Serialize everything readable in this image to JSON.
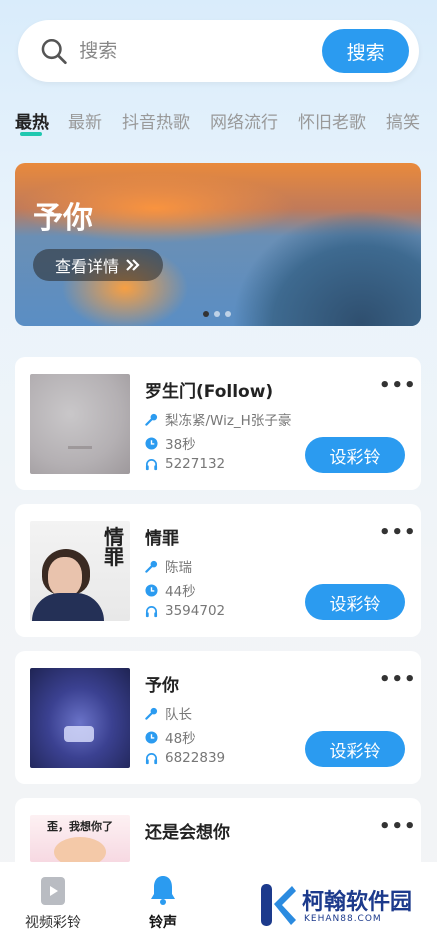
{
  "search": {
    "placeholder": "搜索",
    "button_label": "搜索"
  },
  "tabs": [
    "最热",
    "最新",
    "抖音热歌",
    "网络流行",
    "怀旧老歌",
    "搞笑"
  ],
  "active_tab": "最热",
  "banner": {
    "title": "予你",
    "button_label": "查看详情",
    "page_indicator": {
      "count": 3,
      "active": 1
    }
  },
  "songs": [
    {
      "title": "罗生门(Follow)",
      "artist": "梨冻紧/Wiz_H张子豪",
      "duration": "38秒",
      "plays": "5227132",
      "action_label": "设彩铃"
    },
    {
      "title": "情罪",
      "artist": "陈瑞",
      "duration": "44秒",
      "plays": "3594702",
      "action_label": "设彩铃"
    },
    {
      "title": "予你",
      "artist": "队长",
      "duration": "48秒",
      "plays": "6822839",
      "action_label": "设彩铃"
    },
    {
      "title": "还是会想你",
      "cover_text": "歪，我想你了"
    }
  ],
  "more_label": "•••",
  "bottom_nav": [
    {
      "label": "视频彩铃",
      "icon": "video-ringtone-icon"
    },
    {
      "label": "铃声",
      "icon": "bell-icon",
      "active": true
    }
  ],
  "watermark": {
    "text": "柯翰软件园",
    "sub": "KEHAN88.COM"
  },
  "colors": {
    "accent": "#2b9bf0",
    "tab_indicator": "#1fc8b0"
  }
}
